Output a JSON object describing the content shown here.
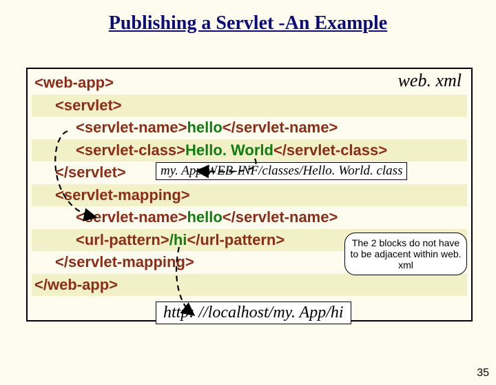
{
  "title": "Publishing a Servlet -An Example",
  "file_label": "web. xml",
  "code": {
    "l1": {
      "t": "<web-app>"
    },
    "l2": {
      "t": "<servlet>"
    },
    "l3": {
      "a": "<servlet-name>",
      "b": "hello",
      "c": "</servlet-name>"
    },
    "l4": {
      "a": "<servlet-class>",
      "b": "Hello. World",
      "c": "</servlet-class>"
    },
    "l5": {
      "t": "</servlet>"
    },
    "l6": {
      "t": "<servlet-mapping>"
    },
    "l7": {
      "a": "<servlet-name>",
      "b": "hello",
      "c": "</servlet-name>"
    },
    "l8": {
      "a": "<url-pattern>",
      "b": "/hi",
      "c": "</url-pattern>"
    },
    "l9": {
      "t": "</servlet-mapping>"
    },
    "l10": {
      "t": "</web-app>"
    }
  },
  "class_path": "my. App/WEB-INF/classes/Hello. World. class",
  "speech": "The 2 blocks do not have to be adjacent within web. xml",
  "url": "http: //localhost/my. App/hi",
  "page_num": "35"
}
